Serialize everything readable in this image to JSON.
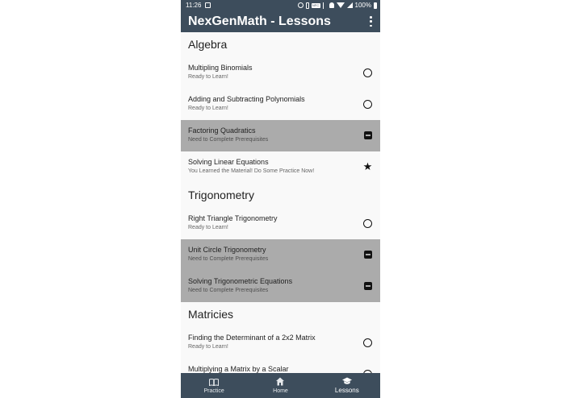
{
  "status_bar": {
    "time": "11:26",
    "nfc": "NFC",
    "battery": "100%"
  },
  "app_bar": {
    "title": "NexGenMath - Lessons"
  },
  "sections": [
    {
      "title": "Algebra",
      "lessons": [
        {
          "title": "Multipling Binomials",
          "subtitle": "Ready to Learn!",
          "status": "ready"
        },
        {
          "title": "Adding and Subtracting Polynomials",
          "subtitle": "Ready to Learn!",
          "status": "ready"
        },
        {
          "title": "Factoring Quadratics",
          "subtitle": "Need to Complete Prerequisites",
          "status": "locked"
        },
        {
          "title": "Solving Linear Equations",
          "subtitle": "You Learned the Material! Do Some Practice Now!",
          "status": "learned"
        }
      ]
    },
    {
      "title": "Trigonometry",
      "lessons": [
        {
          "title": "Right Triangle Trigonometry",
          "subtitle": "Ready to Learn!",
          "status": "ready"
        },
        {
          "title": "Unit Circle Trigonometry",
          "subtitle": "Need to Complete Prerequisites",
          "status": "locked"
        },
        {
          "title": "Solving Trigonometric Equations",
          "subtitle": "Need to Complete Prerequisites",
          "status": "locked"
        }
      ]
    },
    {
      "title": "Matricies",
      "lessons": [
        {
          "title": "Finding the Determinant of a 2x2 Matrix",
          "subtitle": "Ready to Learn!",
          "status": "ready"
        },
        {
          "title": "Multiplying a Matrix by a Scalar",
          "subtitle": "",
          "status": "ready"
        }
      ]
    }
  ],
  "bottom_nav": {
    "items": [
      {
        "label": "Practice",
        "icon": "book-icon"
      },
      {
        "label": "Home",
        "icon": "home-icon"
      },
      {
        "label": "Lessons",
        "icon": "school-icon",
        "active": true
      }
    ]
  },
  "colors": {
    "primary": "#3d4d5c",
    "locked_row": "#ababab",
    "background": "#f9f9f9"
  }
}
